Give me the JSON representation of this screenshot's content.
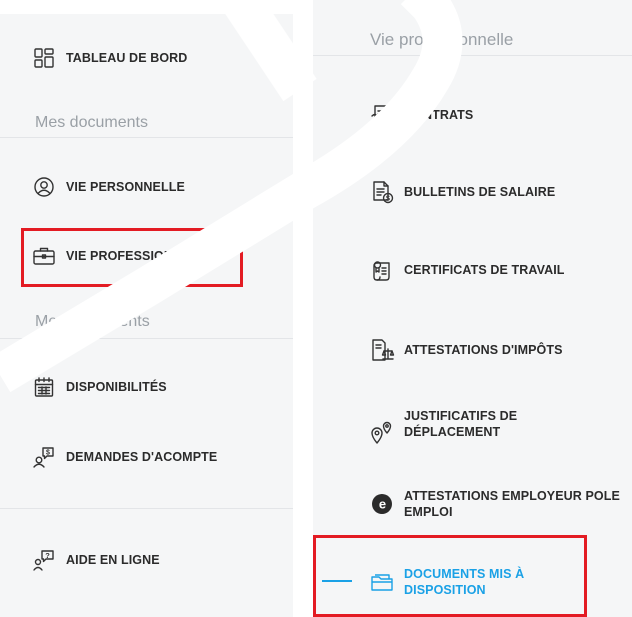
{
  "sidebar": {
    "dashboard_label": "TABLEAU DE BORD",
    "section_documents": "Mes documents",
    "vie_personnelle_label": "VIE PERSONNELLE",
    "vie_professionnelle_label": "VIE PROFESSIONNELLE",
    "section_traitements": "Mes traîtements",
    "disponibilites_label": "DISPONIBILITÉS",
    "demandes_acompte_label": "DEMANDES D'ACOMPTE",
    "aide_label": "AIDE EN LIGNE"
  },
  "submenu": {
    "title": "Vie professionnelle",
    "items": [
      {
        "label": "CONTRATS",
        "icon": "contract-icon"
      },
      {
        "label": "BULLETINS DE SALAIRE",
        "icon": "payslip-icon"
      },
      {
        "label": "CERTIFICATS DE TRAVAIL",
        "icon": "certificate-icon"
      },
      {
        "label": "ATTESTATIONS D'IMPÔTS",
        "icon": "tax-scale-icon"
      },
      {
        "label": "JUSTIFICATIFS DE DÉPLACEMENT",
        "icon": "location-pins-icon"
      },
      {
        "label": "ATTESTATIONS EMPLOYEUR POLE EMPLOI",
        "icon": "pole-emploi-icon"
      },
      {
        "label": "DOCUMENTS MIS À DISPOSITION",
        "icon": "folder-icon"
      }
    ]
  },
  "colors": {
    "highlight": "#e31b23",
    "accent": "#1aa1e6",
    "section_text": "#9aa0a6"
  }
}
